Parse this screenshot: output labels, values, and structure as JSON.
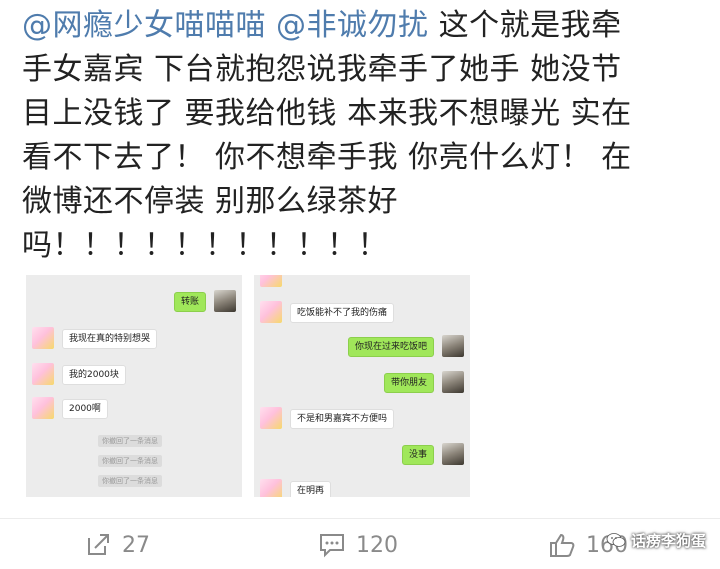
{
  "post": {
    "mention1": "@网瘾少女喵喵喵",
    "mention2": "@非诚勿扰",
    "line1": "这个就是我牵",
    "line2": "手女嘉宾 下台就抱怨说我牵手了她手 她没节",
    "line3": "目上没钱了 要我给他钱 本来我不想曝光 实在",
    "line4": "看不下去了！ 你不想牵手我 你亮什么灯！ 在",
    "line5": "微博还不停装 别那么绿茶好",
    "line6": "吗！！！！！！！！！！！"
  },
  "screenshot_left": {
    "messages": [
      {
        "side": "right",
        "text": "转账"
      },
      {
        "side": "left",
        "text": "我现在真的特别想哭"
      },
      {
        "side": "left",
        "text": "我的2000块"
      },
      {
        "side": "left",
        "text": "2000啊"
      }
    ],
    "system_notes": [
      "你撤回了一条消息",
      "你撤回了一条消息",
      "你撤回了一条消息"
    ]
  },
  "screenshot_right": {
    "messages": [
      {
        "side": "left",
        "text": "吃饭能补不了我的伤痛"
      },
      {
        "side": "right",
        "text": "你现在过来吃饭吧"
      },
      {
        "side": "right",
        "text": "带你朋友"
      },
      {
        "side": "left",
        "text": "不是和男嘉宾不方便吗"
      },
      {
        "side": "right",
        "text": "没事"
      },
      {
        "side": "left",
        "text": "在明再"
      }
    ]
  },
  "actions": {
    "repost_count": "27",
    "comment_count": "120",
    "like_count": "160",
    "repost_icon": "repost-icon",
    "comment_icon": "comment-icon",
    "like_icon": "thumbs-up-icon"
  },
  "watermark": {
    "text": "话痨李狗蛋",
    "icon": "wechat-icon"
  }
}
